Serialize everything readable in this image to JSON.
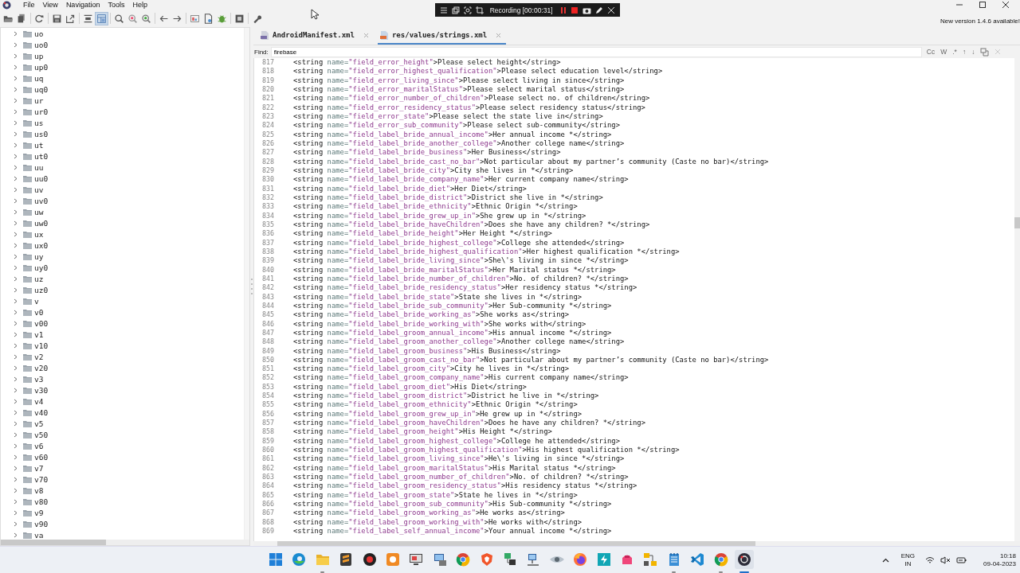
{
  "menu": {
    "items": [
      "File",
      "View",
      "Navigation",
      "Tools",
      "Help"
    ]
  },
  "recorder": {
    "label": "Recording [00:00:31]"
  },
  "toolbar": {
    "buttons": [
      {
        "kind": "open",
        "selected": false
      },
      {
        "kind": "files",
        "selected": false
      },
      {
        "kind": "separator"
      },
      {
        "kind": "refresh",
        "selected": false
      },
      {
        "kind": "separator"
      },
      {
        "kind": "save",
        "selected": false
      },
      {
        "kind": "export",
        "selected": false
      },
      {
        "kind": "separator"
      },
      {
        "kind": "align",
        "selected": false
      },
      {
        "kind": "layout",
        "selected": true
      },
      {
        "kind": "separator"
      },
      {
        "kind": "search",
        "selected": false
      },
      {
        "kind": "search-red",
        "selected": false
      },
      {
        "kind": "search-green",
        "selected": false
      },
      {
        "kind": "separator"
      },
      {
        "kind": "back",
        "selected": false
      },
      {
        "kind": "forward",
        "selected": false
      },
      {
        "kind": "separator"
      },
      {
        "kind": "image",
        "selected": false
      },
      {
        "kind": "page",
        "selected": false
      },
      {
        "kind": "bug",
        "selected": false
      },
      {
        "kind": "separator"
      },
      {
        "kind": "stop",
        "selected": false
      },
      {
        "kind": "separator"
      },
      {
        "kind": "wrench",
        "selected": false
      }
    ],
    "notice": "New version 1.4.6 available!"
  },
  "tree": {
    "items": [
      {
        "label": "uo",
        "expanded": false
      },
      {
        "label": "uo0",
        "expanded": false
      },
      {
        "label": "up",
        "expanded": false
      },
      {
        "label": "up0",
        "expanded": false
      },
      {
        "label": "uq",
        "expanded": false
      },
      {
        "label": "uq0",
        "expanded": false
      },
      {
        "label": "ur",
        "expanded": false
      },
      {
        "label": "ur0",
        "expanded": false
      },
      {
        "label": "us",
        "expanded": false
      },
      {
        "label": "us0",
        "expanded": false
      },
      {
        "label": "ut",
        "expanded": false
      },
      {
        "label": "ut0",
        "expanded": false
      },
      {
        "label": "uu",
        "expanded": false
      },
      {
        "label": "uu0",
        "expanded": false
      },
      {
        "label": "uv",
        "expanded": false
      },
      {
        "label": "uv0",
        "expanded": false
      },
      {
        "label": "uw",
        "expanded": false
      },
      {
        "label": "uw0",
        "expanded": false
      },
      {
        "label": "ux",
        "expanded": false
      },
      {
        "label": "ux0",
        "expanded": false
      },
      {
        "label": "uy",
        "expanded": false
      },
      {
        "label": "uy0",
        "expanded": false
      },
      {
        "label": "uz",
        "expanded": false
      },
      {
        "label": "uz0",
        "expanded": false
      },
      {
        "label": "v",
        "expanded": false
      },
      {
        "label": "v0",
        "expanded": false
      },
      {
        "label": "v00",
        "expanded": false
      },
      {
        "label": "v1",
        "expanded": false
      },
      {
        "label": "v10",
        "expanded": false
      },
      {
        "label": "v2",
        "expanded": false
      },
      {
        "label": "v20",
        "expanded": false
      },
      {
        "label": "v3",
        "expanded": false
      },
      {
        "label": "v30",
        "expanded": false
      },
      {
        "label": "v4",
        "expanded": false
      },
      {
        "label": "v40",
        "expanded": false
      },
      {
        "label": "v5",
        "expanded": false
      },
      {
        "label": "v50",
        "expanded": false
      },
      {
        "label": "v6",
        "expanded": false
      },
      {
        "label": "v60",
        "expanded": false
      },
      {
        "label": "v7",
        "expanded": false
      },
      {
        "label": "v70",
        "expanded": false
      },
      {
        "label": "v8",
        "expanded": false
      },
      {
        "label": "v80",
        "expanded": false
      },
      {
        "label": "v9",
        "expanded": false
      },
      {
        "label": "v90",
        "expanded": false
      },
      {
        "label": "va",
        "expanded": false
      }
    ]
  },
  "tabs": [
    {
      "label": "AndroidManifest.xml",
      "selected": false
    },
    {
      "label": "res/values/strings.xml",
      "selected": true
    }
  ],
  "find": {
    "label": "Find:",
    "value": "firebase",
    "options": [
      "Cc",
      "W",
      ".*",
      "↑",
      "↓"
    ]
  },
  "editor": {
    "lines": [
      {
        "number": "817",
        "tag": "<string",
        "attr": "name=",
        "key": "\"field_error_height\"",
        "text": ">Please select height</string>"
      },
      {
        "number": "818",
        "tag": "<string",
        "attr": "name=",
        "key": "\"field_error_highest_qualification\"",
        "text": ">Please select education level</string>"
      },
      {
        "number": "819",
        "tag": "<string",
        "attr": "name=",
        "key": "\"field_error_living_since\"",
        "text": ">Please select living in since</string>"
      },
      {
        "number": "820",
        "tag": "<string",
        "attr": "name=",
        "key": "\"field_error_maritalStatus\"",
        "text": ">Please select marital status</string>"
      },
      {
        "number": "821",
        "tag": "<string",
        "attr": "name=",
        "key": "\"field_error_number_of_children\"",
        "text": ">Please select no. of children</string>"
      },
      {
        "number": "822",
        "tag": "<string",
        "attr": "name=",
        "key": "\"field_error_residency_status\"",
        "text": ">Please select residency status</string>"
      },
      {
        "number": "823",
        "tag": "<string",
        "attr": "name=",
        "key": "\"field_error_state\"",
        "text": ">Please select the state live in</string>"
      },
      {
        "number": "824",
        "tag": "<string",
        "attr": "name=",
        "key": "\"field_error_sub_community\"",
        "text": ">Please select sub-community</string>"
      },
      {
        "number": "825",
        "tag": "<string",
        "attr": "name=",
        "key": "\"field_label_bride_annual_income\"",
        "text": ">Her annual income *</string>"
      },
      {
        "number": "826",
        "tag": "<string",
        "attr": "name=",
        "key": "\"field_label_bride_another_college\"",
        "text": ">Another college name</string>"
      },
      {
        "number": "827",
        "tag": "<string",
        "attr": "name=",
        "key": "\"field_label_bride_business\"",
        "text": ">Her Business</string>"
      },
      {
        "number": "828",
        "tag": "<string",
        "attr": "name=",
        "key": "\"field_label_bride_cast_no_bar\"",
        "text": ">Not particular about my partner’s community (Caste no bar)</string>"
      },
      {
        "number": "829",
        "tag": "<string",
        "attr": "name=",
        "key": "\"field_label_bride_city\"",
        "text": ">City she lives in *</string>"
      },
      {
        "number": "830",
        "tag": "<string",
        "attr": "name=",
        "key": "\"field_label_bride_company_name\"",
        "text": ">Her current company name</string>"
      },
      {
        "number": "831",
        "tag": "<string",
        "attr": "name=",
        "key": "\"field_label_bride_diet\"",
        "text": ">Her Diet</string>"
      },
      {
        "number": "832",
        "tag": "<string",
        "attr": "name=",
        "key": "\"field_label_bride_district\"",
        "text": ">District she live in *</string>"
      },
      {
        "number": "833",
        "tag": "<string",
        "attr": "name=",
        "key": "\"field_label_bride_ethnicity\"",
        "text": ">Ethnic Origin *</string>"
      },
      {
        "number": "834",
        "tag": "<string",
        "attr": "name=",
        "key": "\"field_label_bride_grew_up_in\"",
        "text": ">She grew up in *</string>"
      },
      {
        "number": "835",
        "tag": "<string",
        "attr": "name=",
        "key": "\"field_label_bride_haveChildren\"",
        "text": ">Does she have any children? *</string>"
      },
      {
        "number": "836",
        "tag": "<string",
        "attr": "name=",
        "key": "\"field_label_bride_height\"",
        "text": ">Her Height *</string>"
      },
      {
        "number": "837",
        "tag": "<string",
        "attr": "name=",
        "key": "\"field_label_bride_highest_college\"",
        "text": ">College she attended</string>"
      },
      {
        "number": "838",
        "tag": "<string",
        "attr": "name=",
        "key": "\"field_label_bride_highest_qualification\"",
        "text": ">Her highest qualification *</string>"
      },
      {
        "number": "839",
        "tag": "<string",
        "attr": "name=",
        "key": "\"field_label_bride_living_since\"",
        "text": ">She\\'s living in since *</string>"
      },
      {
        "number": "840",
        "tag": "<string",
        "attr": "name=",
        "key": "\"field_label_bride_maritalStatus\"",
        "text": ">Her Marital status *</string>"
      },
      {
        "number": "841",
        "tag": "<string",
        "attr": "name=",
        "key": "\"field_label_bride_number_of_children\"",
        "text": ">No. of children? *</string>"
      },
      {
        "number": "842",
        "tag": "<string",
        "attr": "name=",
        "key": "\"field_label_bride_residency_status\"",
        "text": ">Her residency status *</string>"
      },
      {
        "number": "843",
        "tag": "<string",
        "attr": "name=",
        "key": "\"field_label_bride_state\"",
        "text": ">State she lives in *</string>"
      },
      {
        "number": "844",
        "tag": "<string",
        "attr": "name=",
        "key": "\"field_label_bride_sub_community\"",
        "text": ">Her Sub-community *</string>"
      },
      {
        "number": "845",
        "tag": "<string",
        "attr": "name=",
        "key": "\"field_label_bride_working_as\"",
        "text": ">She works as</string>"
      },
      {
        "number": "846",
        "tag": "<string",
        "attr": "name=",
        "key": "\"field_label_bride_working_with\"",
        "text": ">She works with</string>"
      },
      {
        "number": "847",
        "tag": "<string",
        "attr": "name=",
        "key": "\"field_label_groom_annual_income\"",
        "text": ">His annual income *</string>"
      },
      {
        "number": "848",
        "tag": "<string",
        "attr": "name=",
        "key": "\"field_label_groom_another_college\"",
        "text": ">Another college name</string>"
      },
      {
        "number": "849",
        "tag": "<string",
        "attr": "name=",
        "key": "\"field_label_groom_business\"",
        "text": ">His Business</string>"
      },
      {
        "number": "850",
        "tag": "<string",
        "attr": "name=",
        "key": "\"field_label_groom_cast_no_bar\"",
        "text": ">Not particular about my partner’s community (Caste no bar)</string>"
      },
      {
        "number": "851",
        "tag": "<string",
        "attr": "name=",
        "key": "\"field_label_groom_city\"",
        "text": ">City he lives in *</string>"
      },
      {
        "number": "852",
        "tag": "<string",
        "attr": "name=",
        "key": "\"field_label_groom_company_name\"",
        "text": ">His current company name</string>"
      },
      {
        "number": "853",
        "tag": "<string",
        "attr": "name=",
        "key": "\"field_label_groom_diet\"",
        "text": ">His Diet</string>"
      },
      {
        "number": "854",
        "tag": "<string",
        "attr": "name=",
        "key": "\"field_label_groom_district\"",
        "text": ">District he live in *</string>"
      },
      {
        "number": "855",
        "tag": "<string",
        "attr": "name=",
        "key": "\"field_label_groom_ethnicity\"",
        "text": ">Ethnic Origin *</string>"
      },
      {
        "number": "856",
        "tag": "<string",
        "attr": "name=",
        "key": "\"field_label_groom_grew_up_in\"",
        "text": ">He grew up in *</string>"
      },
      {
        "number": "857",
        "tag": "<string",
        "attr": "name=",
        "key": "\"field_label_groom_haveChildren\"",
        "text": ">Does he have any children? *</string>"
      },
      {
        "number": "858",
        "tag": "<string",
        "attr": "name=",
        "key": "\"field_label_groom_height\"",
        "text": ">His Height *</string>"
      },
      {
        "number": "859",
        "tag": "<string",
        "attr": "name=",
        "key": "\"field_label_groom_highest_college\"",
        "text": ">College he attended</string>"
      },
      {
        "number": "860",
        "tag": "<string",
        "attr": "name=",
        "key": "\"field_label_groom_highest_qualification\"",
        "text": ">His highest qualification *</string>"
      },
      {
        "number": "861",
        "tag": "<string",
        "attr": "name=",
        "key": "\"field_label_groom_living_since\"",
        "text": ">He\\'s living in since *</string>"
      },
      {
        "number": "862",
        "tag": "<string",
        "attr": "name=",
        "key": "\"field_label_groom_maritalStatus\"",
        "text": ">His Marital status *</string>"
      },
      {
        "number": "863",
        "tag": "<string",
        "attr": "name=",
        "key": "\"field_label_groom_number_of_children\"",
        "text": ">No. of children? *</string>"
      },
      {
        "number": "864",
        "tag": "<string",
        "attr": "name=",
        "key": "\"field_label_groom_residency_status\"",
        "text": ">His residency status *</string>"
      },
      {
        "number": "865",
        "tag": "<string",
        "attr": "name=",
        "key": "\"field_label_groom_state\"",
        "text": ">State he lives in *</string>"
      },
      {
        "number": "866",
        "tag": "<string",
        "attr": "name=",
        "key": "\"field_label_groom_sub_community\"",
        "text": ">His Sub-community *</string>"
      },
      {
        "number": "867",
        "tag": "<string",
        "attr": "name=",
        "key": "\"field_label_groom_working_as\"",
        "text": ">He works as</string>"
      },
      {
        "number": "868",
        "tag": "<string",
        "attr": "name=",
        "key": "\"field_label_groom_working_with\"",
        "text": ">He works with</string>"
      },
      {
        "number": "869",
        "tag": "<string",
        "attr": "name=",
        "key": "\"field_label_self_annual_income\"",
        "text": ">Your annual income *</string>"
      }
    ]
  },
  "taskbar": {
    "apps": [
      {
        "kind": "start",
        "running": false,
        "selected": false
      },
      {
        "kind": "edge",
        "running": false,
        "selected": false
      },
      {
        "kind": "files",
        "running": true,
        "selected": false
      },
      {
        "kind": "sublime",
        "running": false,
        "selected": false
      },
      {
        "kind": "record",
        "running": false,
        "selected": false
      },
      {
        "kind": "orange",
        "running": false,
        "selected": false
      },
      {
        "kind": "snip",
        "running": false,
        "selected": false
      },
      {
        "kind": "computer",
        "running": false,
        "selected": false
      },
      {
        "kind": "chrome",
        "running": false,
        "selected": false
      },
      {
        "kind": "brave",
        "running": false,
        "selected": false
      },
      {
        "kind": "network",
        "running": false,
        "selected": false
      },
      {
        "kind": "network2",
        "running": false,
        "selected": false
      },
      {
        "kind": "eye",
        "running": false,
        "selected": false
      },
      {
        "kind": "firefox",
        "running": false,
        "selected": false
      },
      {
        "kind": "teal",
        "running": false,
        "selected": false
      },
      {
        "kind": "pink",
        "running": false,
        "selected": false
      },
      {
        "kind": "diagram",
        "running": false,
        "selected": false
      },
      {
        "kind": "notepad",
        "running": true,
        "selected": false
      },
      {
        "kind": "vscode",
        "running": false,
        "selected": false
      },
      {
        "kind": "chrome",
        "running": true,
        "selected": false
      },
      {
        "kind": "jadx",
        "running": true,
        "selected": true
      }
    ],
    "language": "ENG",
    "region": "IN",
    "time": "10:18",
    "date": "09-04-2023"
  }
}
